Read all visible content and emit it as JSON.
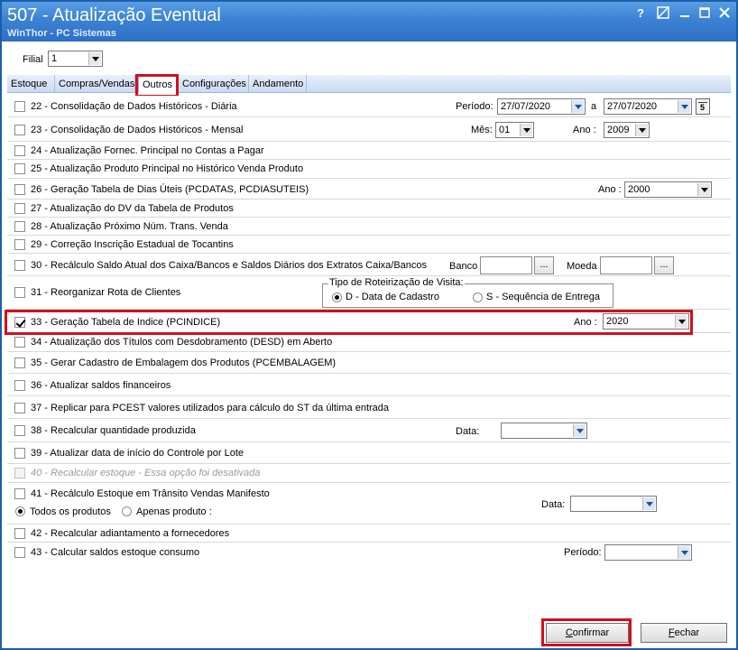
{
  "window": {
    "title": "507 - Atualização Eventual",
    "subtitle": "WinThor - PC Sistemas"
  },
  "filial": {
    "label": "Filial",
    "value": "1"
  },
  "tabs": [
    {
      "label": "Estoque"
    },
    {
      "label": "Compras/Vendas"
    },
    {
      "label": "Outros"
    },
    {
      "label": "Configurações"
    },
    {
      "label": "Andamento"
    }
  ],
  "options": {
    "o22": {
      "label": "22 - Consolidação de Dados Históricos - Diária",
      "checked": false
    },
    "o23": {
      "label": "23 - Consolidação de Dados Históricos - Mensal",
      "checked": false
    },
    "o24": {
      "label": "24 - Atualização Fornec. Principal no Contas a Pagar",
      "checked": false
    },
    "o25": {
      "label": "25 - Atualização Produto Principal no Histórico Venda Produto",
      "checked": false
    },
    "o26": {
      "label": "26 - Geração Tabela de Dias Úteis (PCDATAS, PCDIASUTEIS)",
      "checked": false
    },
    "o27": {
      "label": "27 - Atualização do DV da Tabela de Produtos",
      "checked": false
    },
    "o28": {
      "label": "28 - Atualização Próximo Núm. Trans. Venda",
      "checked": false
    },
    "o29": {
      "label": "29 - Correção Inscrição Estadual de Tocantins",
      "checked": false
    },
    "o30": {
      "label": "30 - Recálculo Saldo Atual dos Caixa/Bancos e Saldos Diários dos Extratos Caixa/Bancos",
      "checked": false
    },
    "o31": {
      "label": "31 - Reorganizar Rota de Clientes",
      "checked": false
    },
    "o33": {
      "label": "33 - Geração Tabela de Indice (PCINDICE)",
      "checked": true
    },
    "o34": {
      "label": "34 - Atualização dos Títulos com Desdobramento (DESD) em Aberto",
      "checked": false
    },
    "o35": {
      "label": "35 - Gerar Cadastro de Embalagem dos Produtos (PCEMBALAGEM)",
      "checked": false
    },
    "o36": {
      "label": "36 - Atualizar saldos financeiros",
      "checked": false
    },
    "o37": {
      "label": "37 - Replicar para PCEST valores utilizados para cálculo do ST da última entrada",
      "checked": false
    },
    "o38": {
      "label": "38 - Recalcular quantidade produzida",
      "checked": false
    },
    "o39": {
      "label": "39 - Atualizar data de início do Controle por Lote",
      "checked": false
    },
    "o40": {
      "label": "40 - Recalcular estoque - Essa opção foi desativada",
      "checked": false,
      "disabled": true
    },
    "o41": {
      "label": "41 - Recálculo Estoque em Trânsito Vendas Manifesto",
      "checked": false
    },
    "o42": {
      "label": "42 - Recalcular adiantamento a fornecedores",
      "checked": false
    },
    "o43": {
      "label": "43 - Calcular saldos estoque consumo",
      "checked": false
    }
  },
  "fields": {
    "periodo_label": "Período:",
    "periodo_from": "27/07/2020",
    "periodo_sep": "a",
    "periodo_to": "27/07/2020",
    "mes_label": "Mês:",
    "mes_value": "01",
    "ano23_label": "Ano :",
    "ano23_value": "2009",
    "ano26_label": "Ano :",
    "ano26_value": "2000",
    "banco_label": "Banco",
    "banco_value": "",
    "moeda_label": "Moeda",
    "moeda_value": "",
    "dots": "...",
    "roteirizacao_title": "Tipo de Roteirização de Visita:",
    "rot_opt_d": "D - Data de Cadastro",
    "rot_opt_s": "S - Sequência de Entrega",
    "ano33_label": "Ano :",
    "ano33_value": "2020",
    "data38_label": "Data:",
    "data38_value": "",
    "prod_opt_all": "Todos os produtos",
    "prod_opt_one": "Apenas produto :",
    "data41_label": "Data:",
    "data41_value": "",
    "periodo43_label": "Período:",
    "periodo43_value": ""
  },
  "buttons": {
    "confirm_prefix": "",
    "confirm_hotkey": "C",
    "confirm_rest": "onfirmar",
    "close_hotkey": "F",
    "close_rest": "echar"
  },
  "colors": {
    "titlebar": "#3b82d4",
    "highlight": "#d0101d"
  }
}
